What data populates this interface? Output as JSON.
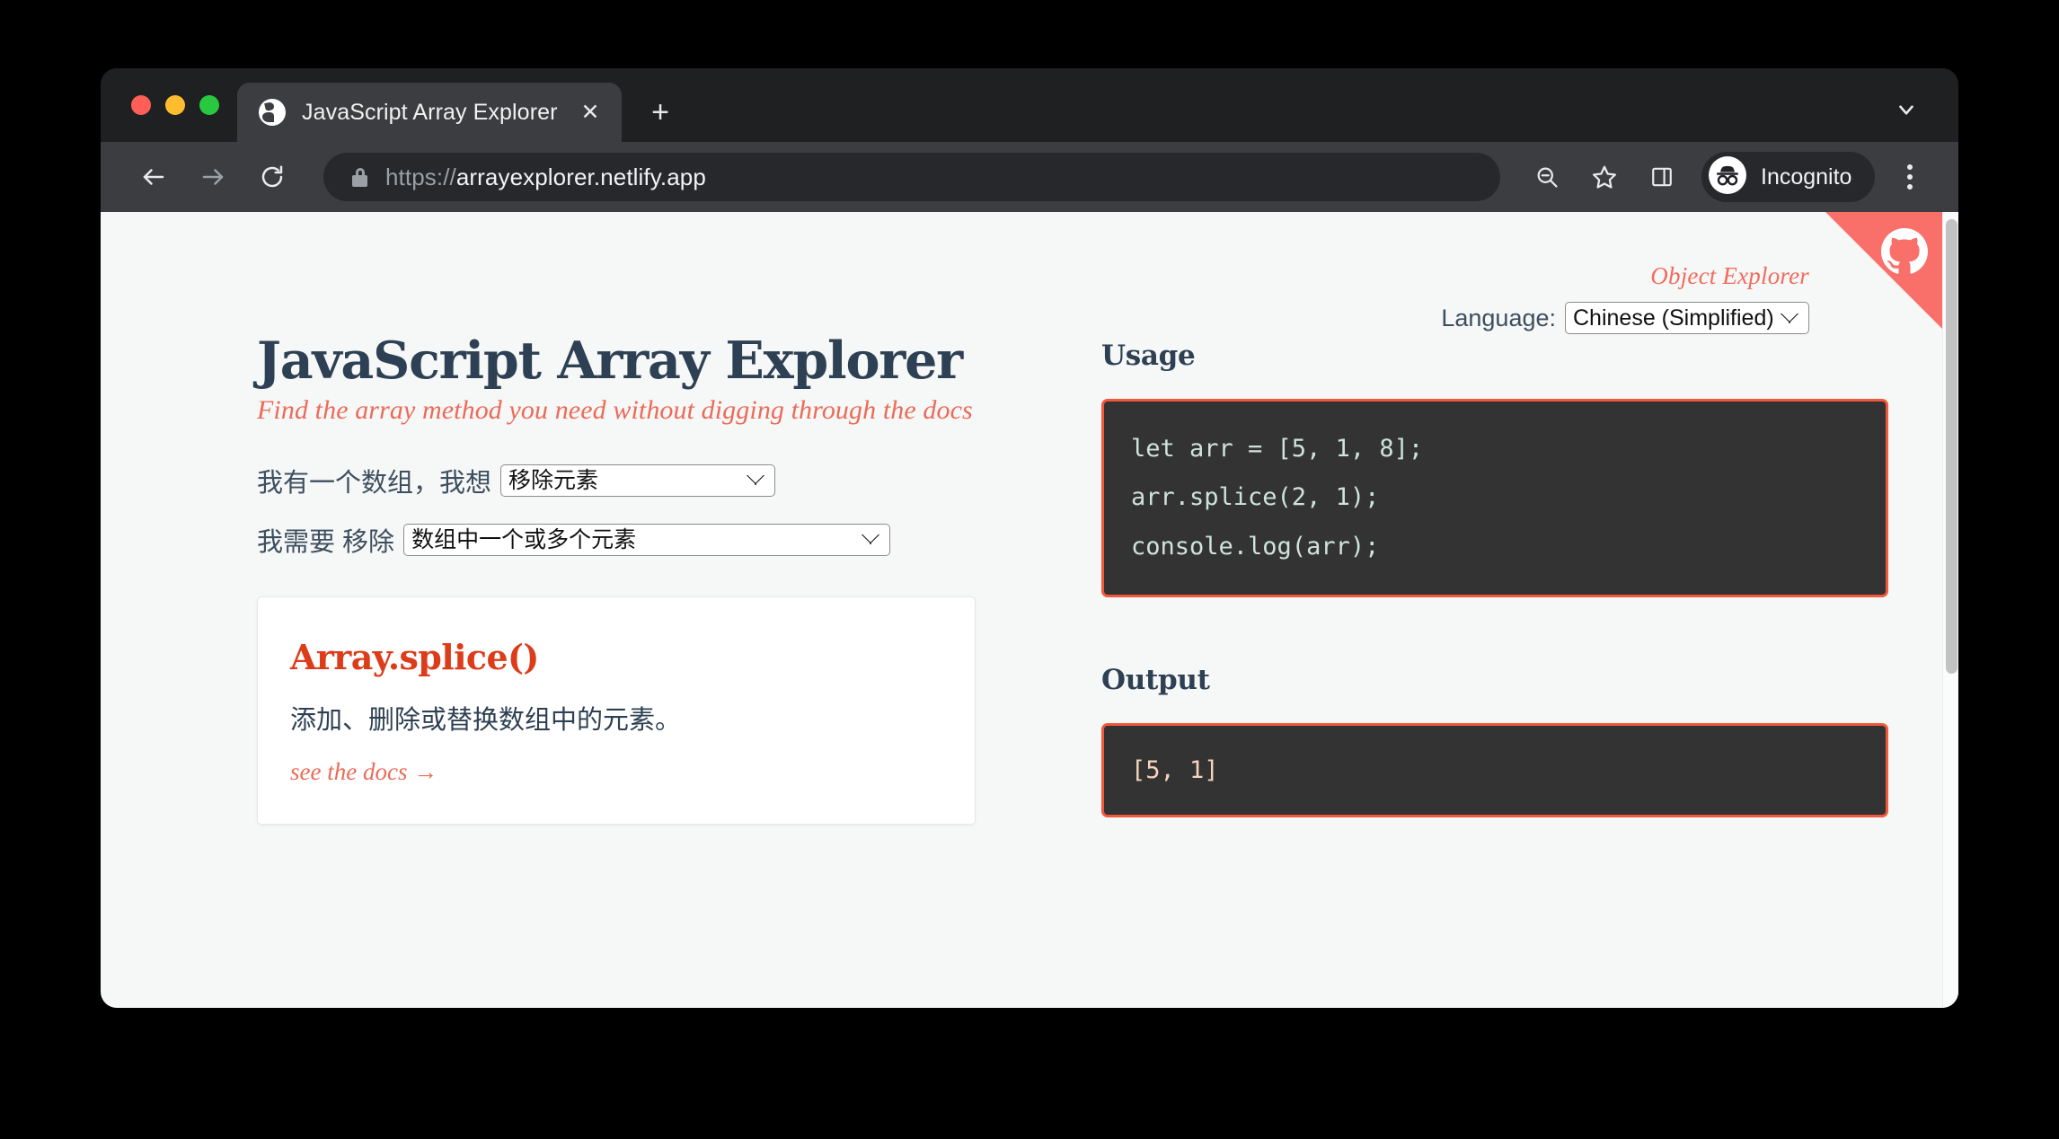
{
  "browser": {
    "tab": {
      "title": "JavaScript Array Explorer",
      "favicon": "globe-icon",
      "close_label": "✕"
    },
    "new_tab_label": "+",
    "toolbar": {
      "back_icon": "back-arrow-icon",
      "forward_icon": "forward-arrow-icon",
      "reload_icon": "reload-icon",
      "lock_icon": "lock-icon",
      "url_scheme": "https://",
      "url_host": "arrayexplorer.netlify.app",
      "zoom_icon": "zoom-out-icon",
      "bookmark_icon": "star-icon",
      "side_panel_icon": "side-panel-icon",
      "profile_label": "Incognito",
      "profile_icon": "incognito-icon",
      "menu_icon": "three-dots-icon"
    }
  },
  "page": {
    "github_corner": "github-octocat-icon",
    "object_explorer_link": "Object Explorer",
    "language_label": "Language:",
    "language_value": "Chinese (Simplified)",
    "language_options": [
      "Chinese (Simplified)"
    ],
    "title": "JavaScript Array Explorer",
    "subtitle": "Find the array method you need without digging through the docs",
    "question_1_label": "我有一个数组，我想",
    "question_1_value": "移除元素",
    "question_1_options": [
      "移除元素"
    ],
    "question_2_label": "我需要 移除",
    "question_2_value": "数组中一个或多个元素",
    "question_2_options": [
      "数组中一个或多个元素"
    ],
    "result": {
      "method_name": "Array.splice()",
      "description": "添加、删除或替换数组中的元素。",
      "docs_link": "see the docs →"
    },
    "usage": {
      "heading": "Usage",
      "line_1": "let arr = [5, 1, 8];",
      "line_2": "arr.splice(2, 1);",
      "line_3": "console.log(arr);"
    },
    "output": {
      "heading": "Output",
      "value": "[5, 1]"
    }
  },
  "colors": {
    "accent_coral": "#f1583c",
    "ribbon": "#f9706b",
    "heading_navy": "#2e4053",
    "method_red": "#dd3c1a",
    "code_bg": "#333333",
    "code_text": "#cfe3da",
    "output_text": "#f6d4bb",
    "page_bg": "#f6f7f7"
  }
}
